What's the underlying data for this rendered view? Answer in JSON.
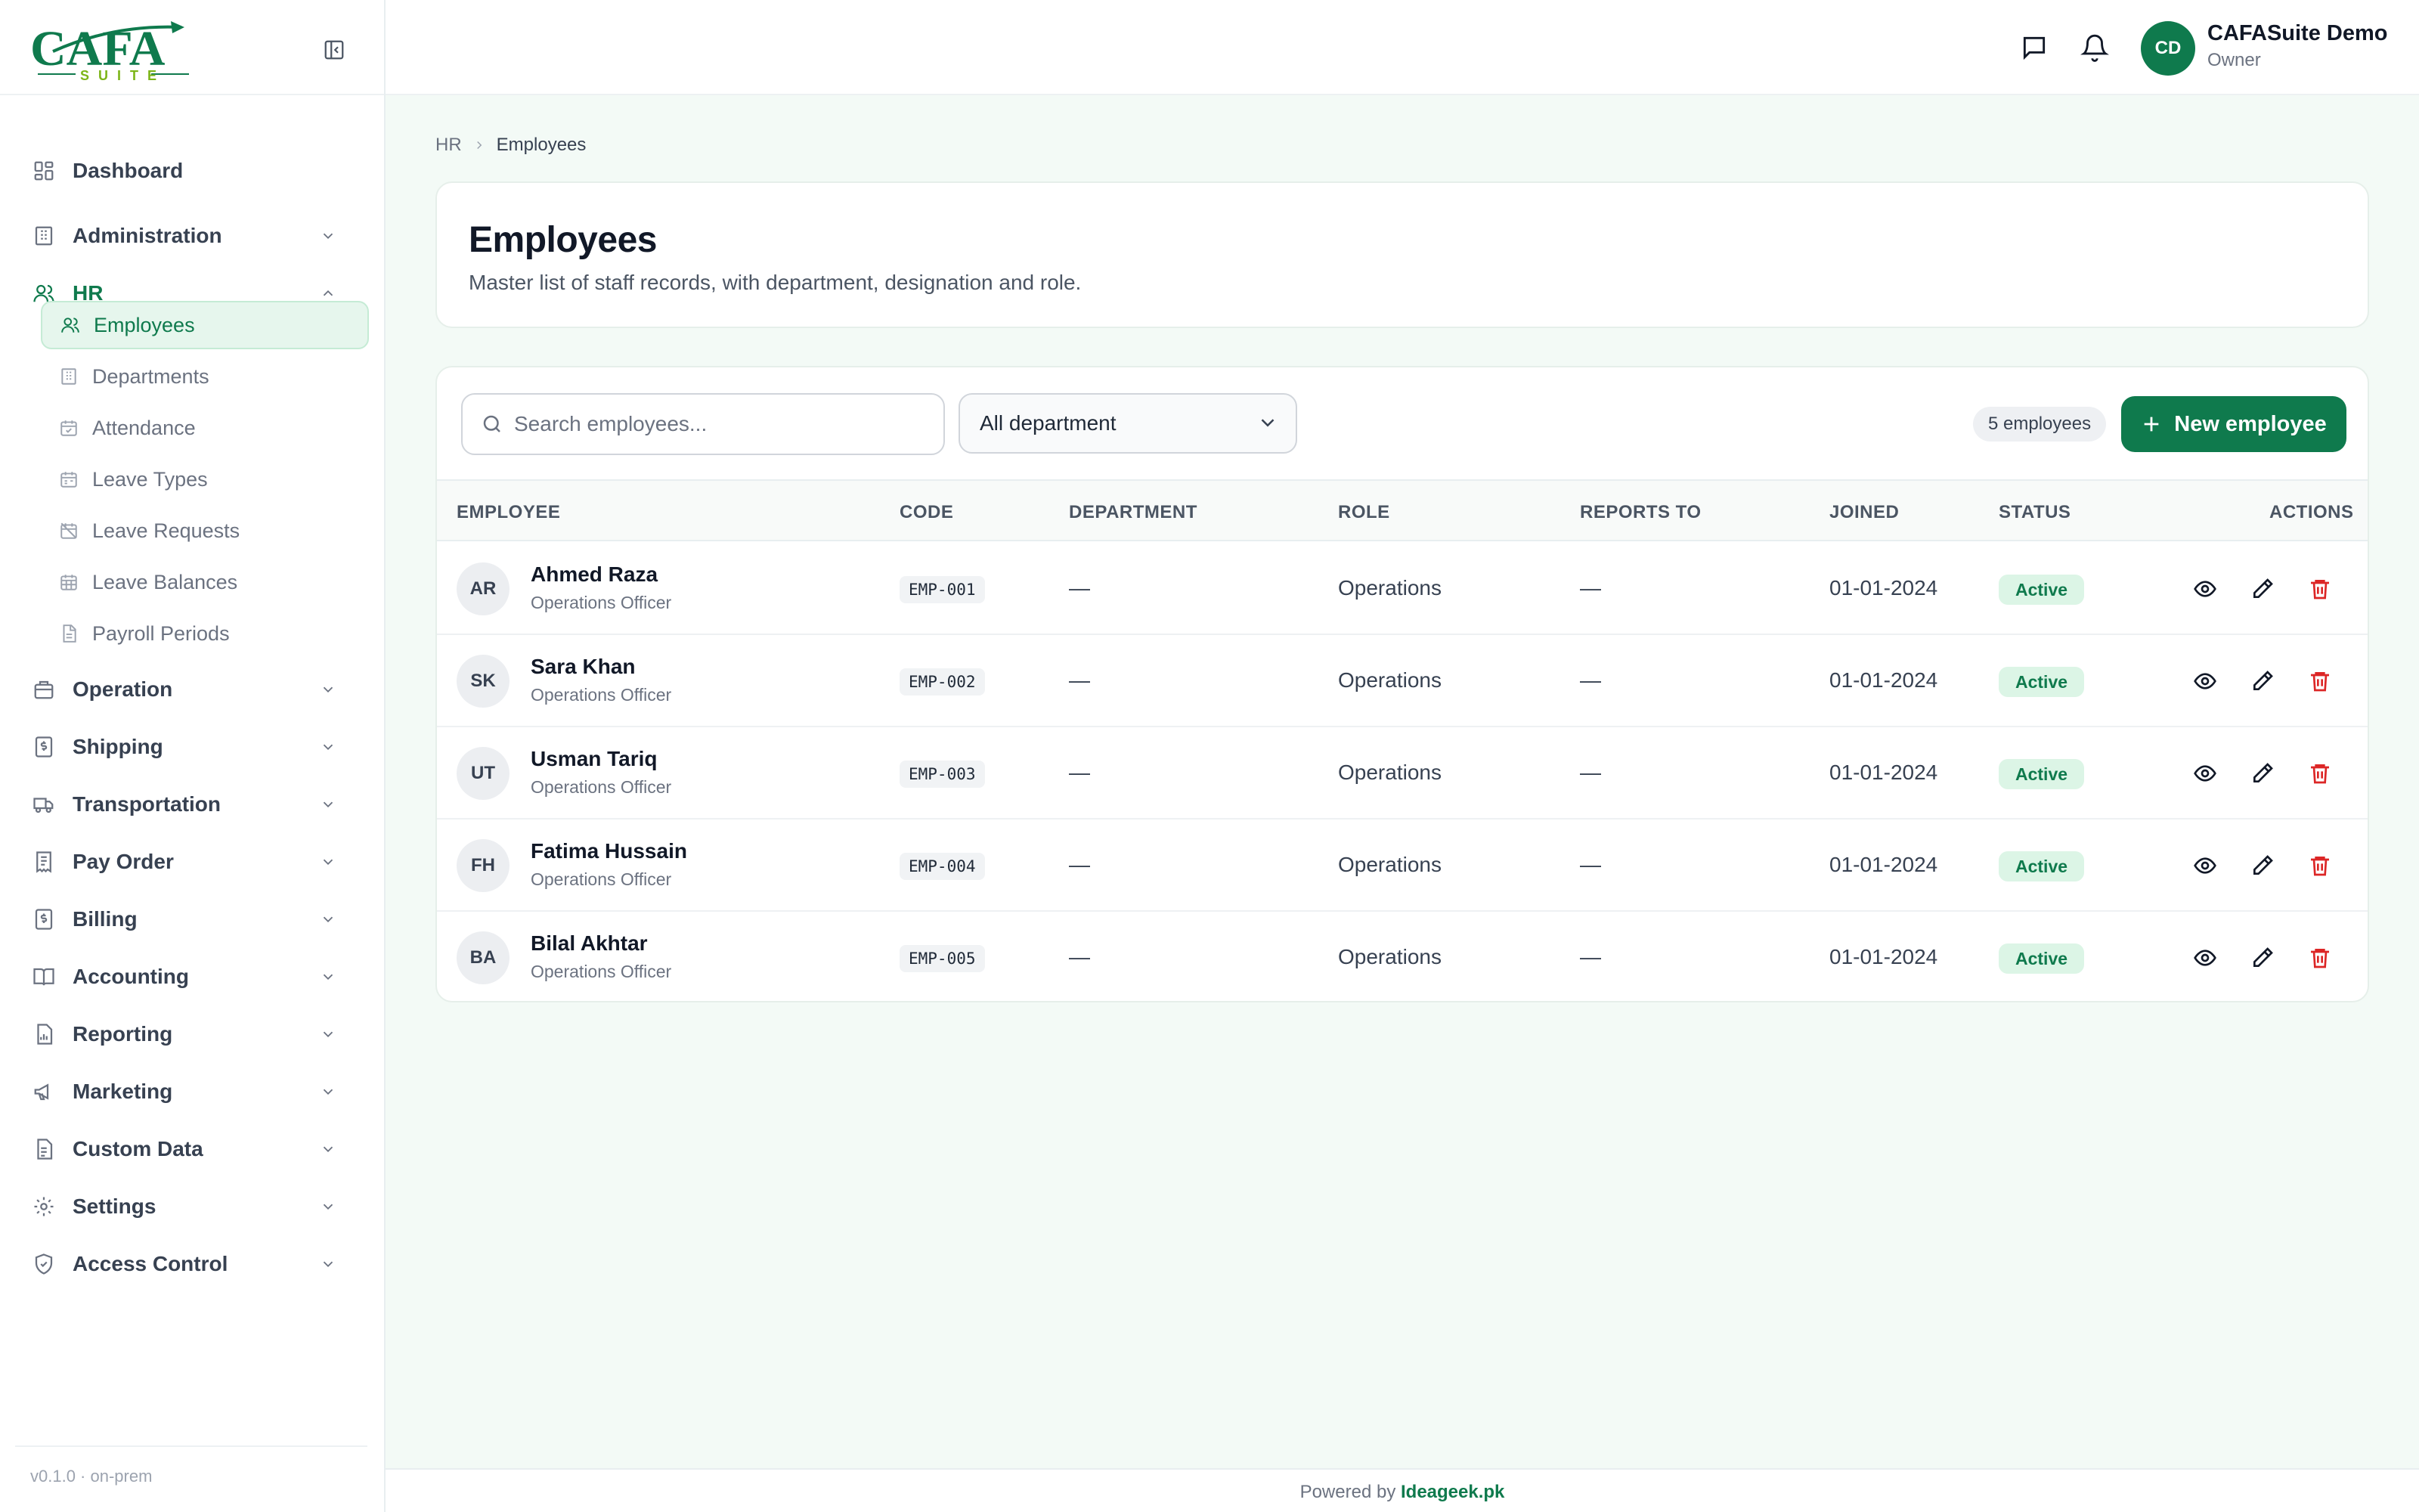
{
  "brand": {
    "logo_text": "CAFA",
    "logo_subtext": "SUITE"
  },
  "sidebar": {
    "items": [
      {
        "label": "Dashboard",
        "icon": "dashboard-icon"
      },
      {
        "label": "Administration",
        "icon": "building-icon"
      },
      {
        "label": "HR",
        "icon": "users-icon"
      },
      {
        "label": "Operation",
        "icon": "briefcase-icon"
      },
      {
        "label": "Shipping",
        "icon": "dollar-doc-icon"
      },
      {
        "label": "Transportation",
        "icon": "truck-icon"
      },
      {
        "label": "Pay Order",
        "icon": "receipt-icon"
      },
      {
        "label": "Billing",
        "icon": "dollar-doc-icon"
      },
      {
        "label": "Accounting",
        "icon": "book-icon"
      },
      {
        "label": "Reporting",
        "icon": "report-icon"
      },
      {
        "label": "Marketing",
        "icon": "megaphone-icon"
      },
      {
        "label": "Custom Data",
        "icon": "form-icon"
      },
      {
        "label": "Settings",
        "icon": "gear-icon"
      },
      {
        "label": "Access Control",
        "icon": "shield-icon"
      }
    ],
    "hr_children": [
      {
        "label": "Employees",
        "icon": "users-icon"
      },
      {
        "label": "Departments",
        "icon": "building-icon"
      },
      {
        "label": "Attendance",
        "icon": "calendar-check-icon"
      },
      {
        "label": "Leave Types",
        "icon": "calendar-icon"
      },
      {
        "label": "Leave Requests",
        "icon": "calendar-off-icon"
      },
      {
        "label": "Leave Balances",
        "icon": "calendar-grid-icon"
      },
      {
        "label": "Payroll Periods",
        "icon": "doc-icon"
      }
    ],
    "version": "v0.1.0 · on-prem"
  },
  "topbar": {
    "user_initials": "CD",
    "user_name": "CAFASuite Demo",
    "user_role": "Owner"
  },
  "breadcrumb": {
    "parent": "HR",
    "current": "Employees"
  },
  "page": {
    "title": "Employees",
    "subtitle": "Master list of staff records, with department, designation and role."
  },
  "toolbar": {
    "search_placeholder": "Search employees...",
    "department_filter": "All department",
    "count_label": "5 employees",
    "new_button": "New employee"
  },
  "table": {
    "headers": {
      "employee": "EMPLOYEE",
      "code": "CODE",
      "department": "DEPARTMENT",
      "role": "ROLE",
      "reports_to": "REPORTS TO",
      "joined": "JOINED",
      "status": "STATUS",
      "actions": "ACTIONS"
    },
    "rows": [
      {
        "initials": "AR",
        "name": "Ahmed Raza",
        "title": "Operations Officer",
        "code": "EMP-001",
        "department": "—",
        "role": "Operations",
        "reports_to": "—",
        "joined": "01-01-2024",
        "status": "Active"
      },
      {
        "initials": "SK",
        "name": "Sara Khan",
        "title": "Operations Officer",
        "code": "EMP-002",
        "department": "—",
        "role": "Operations",
        "reports_to": "—",
        "joined": "01-01-2024",
        "status": "Active"
      },
      {
        "initials": "UT",
        "name": "Usman Tariq",
        "title": "Operations Officer",
        "code": "EMP-003",
        "department": "—",
        "role": "Operations",
        "reports_to": "—",
        "joined": "01-01-2024",
        "status": "Active"
      },
      {
        "initials": "FH",
        "name": "Fatima Hussain",
        "title": "Operations Officer",
        "code": "EMP-004",
        "department": "—",
        "role": "Operations",
        "reports_to": "—",
        "joined": "01-01-2024",
        "status": "Active"
      },
      {
        "initials": "BA",
        "name": "Bilal Akhtar",
        "title": "Operations Officer",
        "code": "EMP-005",
        "department": "—",
        "role": "Operations",
        "reports_to": "—",
        "joined": "01-01-2024",
        "status": "Active"
      }
    ]
  },
  "footer": {
    "prefix": "Powered by",
    "brand": "Ideageek.pk"
  },
  "colors": {
    "accent": "#0f7a4d",
    "danger": "#dc2626",
    "active_bg": "#dcf5e6"
  }
}
